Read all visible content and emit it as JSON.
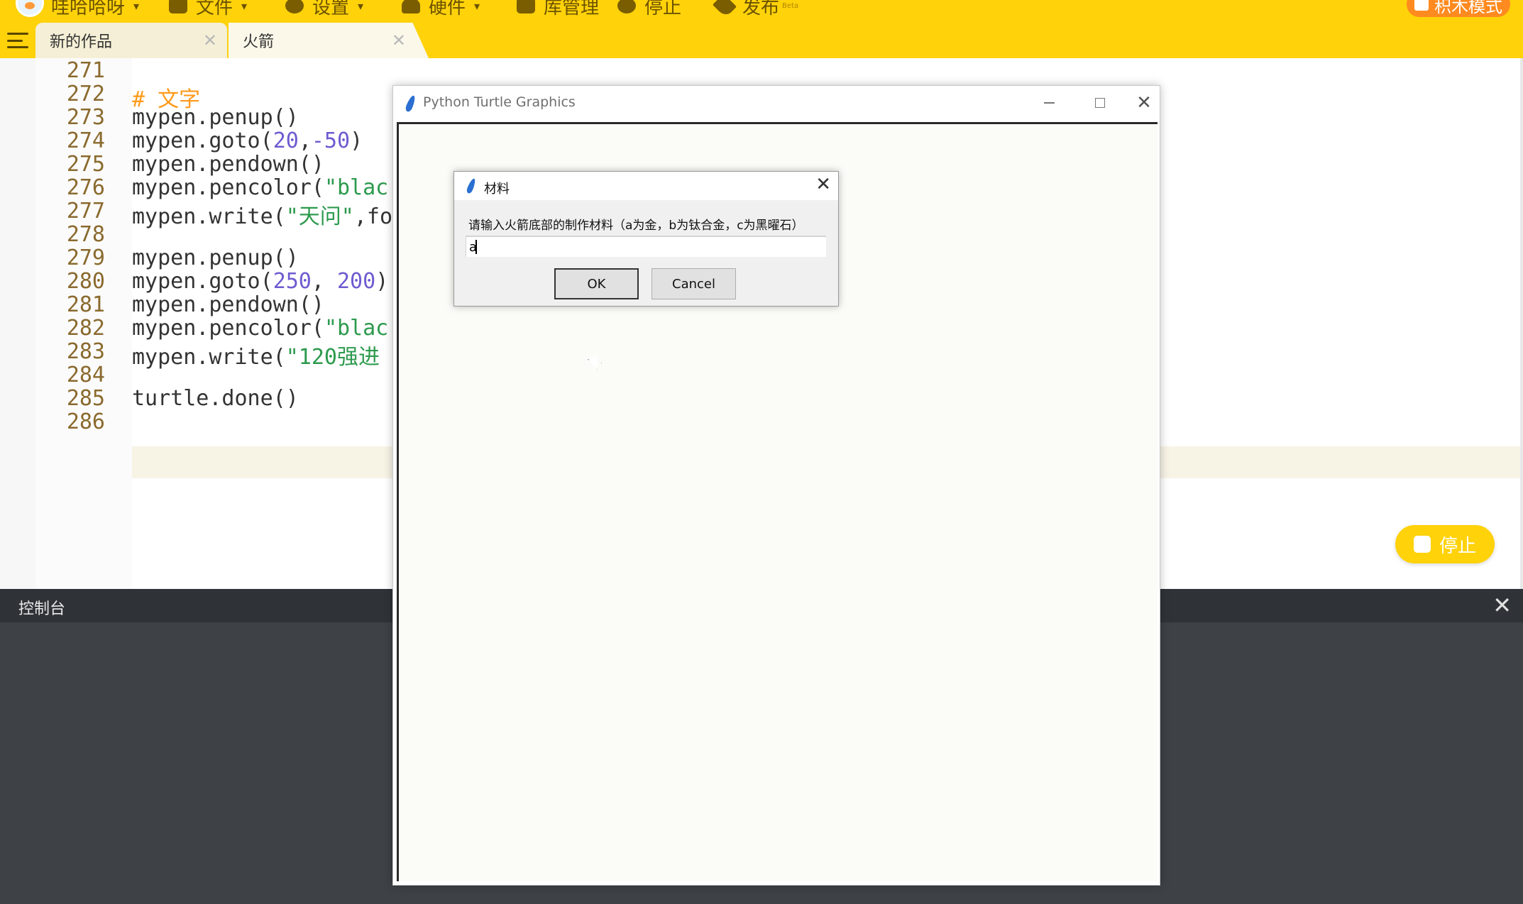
{
  "app": {
    "user_name": "哇哈哈呀",
    "menu": [
      "文件",
      "设置",
      "硬件",
      "库管理",
      "停止",
      "发布"
    ],
    "publish_badge": "Beta",
    "mode_button": "积木模式"
  },
  "tabs": [
    {
      "label": "新的作品",
      "close": "✕"
    },
    {
      "label": "火箭",
      "close": "✕"
    }
  ],
  "editor": {
    "lines": [
      {
        "num": "271",
        "code": ""
      },
      {
        "num": "272",
        "code": "# 文字"
      },
      {
        "num": "273",
        "code": "mypen.penup()"
      },
      {
        "num": "274",
        "code": "mypen.goto(20,-50)"
      },
      {
        "num": "275",
        "code": "mypen.pendown()"
      },
      {
        "num": "276",
        "code": "mypen.pencolor(\"blac"
      },
      {
        "num": "277",
        "code": "mypen.write(\"天问\",fo"
      },
      {
        "num": "278",
        "code": ""
      },
      {
        "num": "279",
        "code": "mypen.penup()"
      },
      {
        "num": "280",
        "code": "mypen.goto(250, 200)"
      },
      {
        "num": "281",
        "code": "mypen.pendown()"
      },
      {
        "num": "282",
        "code": "mypen.pencolor(\"blac"
      },
      {
        "num": "283",
        "code": "mypen.write(\"120强进"
      },
      {
        "num": "284",
        "code": ""
      },
      {
        "num": "285",
        "code": "turtle.done()"
      },
      {
        "num": "286",
        "code": ""
      }
    ],
    "current_line": "283",
    "stop_button": "停止"
  },
  "console": {
    "title": "控制台",
    "close": "✕"
  },
  "turtle_window": {
    "title": "Python Turtle Graphics",
    "close": "✕"
  },
  "dialog": {
    "title": "材料",
    "close": "✕",
    "prompt": "请输入火箭底部的制作材料（a为金，b为钛合金，c为黑曜石）",
    "input_value": "a",
    "ok_label": "OK",
    "cancel_label": "Cancel"
  },
  "colors": {
    "accent": "#FFD20A",
    "mode_button": "#FF8A1F",
    "console_bg": "#3E4247",
    "number_literal": "#6d5bd0",
    "string_literal": "#2d9a4e",
    "comment": "#ff9a1a"
  }
}
